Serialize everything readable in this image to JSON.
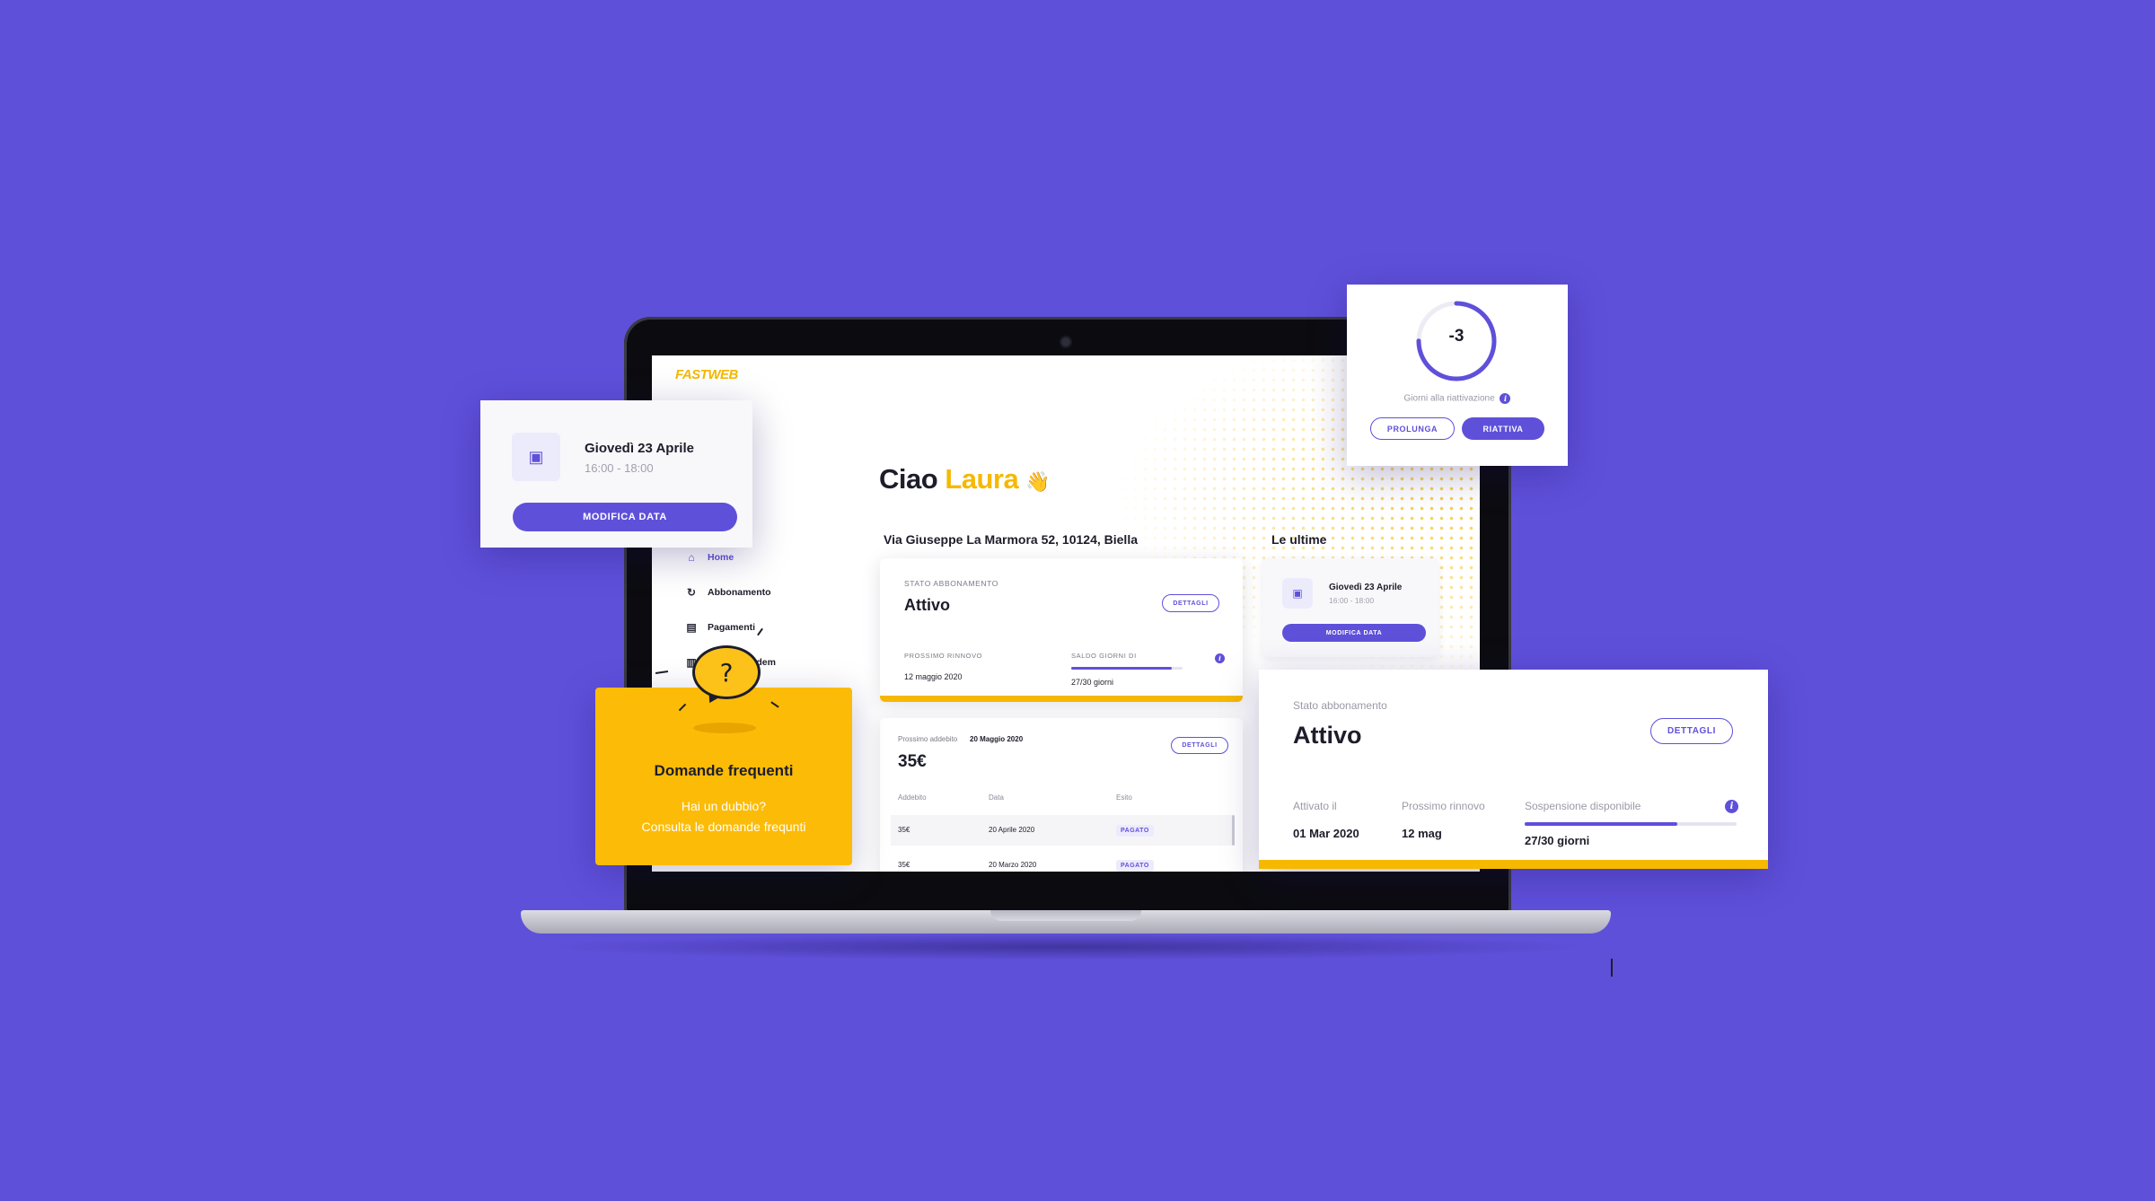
{
  "screen": {
    "logo": "FASTWEB",
    "greeting": "Ciao",
    "user_name": "Laura",
    "wave_emoji": "👋",
    "address": "Via Giuseppe La Marmora 52, 10124, Biella",
    "recent_title": "Le ultime",
    "nav": [
      {
        "label": "Home",
        "icon": "home-icon"
      },
      {
        "label": "Abbonamento",
        "icon": "refresh-icon"
      },
      {
        "label": "Pagamenti",
        "icon": "wallet-icon"
      },
      {
        "label": "ne Modem",
        "icon": "modem-icon"
      }
    ],
    "subscription_card": {
      "label": "STATO ABBONAMENTO",
      "status": "Attivo",
      "button": "DETTAGLI",
      "renewal_label": "PROSSIMO RINNOVO",
      "renewal_value": "12 maggio 2020",
      "balance_label": "SALDO GIORNI DI",
      "balance_value": "27/30 giorni",
      "balance_progress": 0.9
    },
    "billing_card": {
      "next_charge_label": "Prossimo addebito",
      "next_charge_date": "20 Maggio 2020",
      "amount": "35€",
      "button": "DETTAGLI",
      "columns": [
        "Addebito",
        "Data",
        "Esito"
      ],
      "rows": [
        {
          "amount": "35€",
          "date": "20 Aprile 2020",
          "status": "PAGATO"
        },
        {
          "amount": "35€",
          "date": "20 Marzo 2020",
          "status": "PAGATO"
        }
      ]
    },
    "appointment_mini": {
      "date": "Giovedì 23 Aprile",
      "time": "16:00 - 18:00",
      "button": "MODIFICA DATA"
    }
  },
  "float_appointment": {
    "date": "Giovedì 23 Aprile",
    "time": "16:00 - 18:00",
    "button": "MODIFICA DATA",
    "icon": "calendar-icon"
  },
  "float_countdown": {
    "value": "-3",
    "label": "Giorni alla riattivazione",
    "progress": 0.75,
    "btn_extend": "PROLUNGA",
    "btn_reactivate": "RIATTIVA"
  },
  "float_subscription": {
    "label": "Stato abbonamento",
    "status": "Attivo",
    "button": "DETTAGLI",
    "activated_label": "Attivato il",
    "activated_value": "01 Mar 2020",
    "renewal_label": "Prossimo rinnovo",
    "renewal_value": "12 mag",
    "suspension_label": "Sospensione disponibile",
    "suspension_value": "27/30 giorni",
    "suspension_progress": 0.72
  },
  "faq": {
    "title": "Domande frequenti",
    "line1": "Hai un dubbio?",
    "line2": "Consulta le domande frequnti",
    "bubble_glyph": "?"
  },
  "colors": {
    "background": "#5f50da",
    "accent": "#5f50da",
    "brand_yellow": "#f6b800",
    "faq_yellow": "#fcbb07"
  }
}
